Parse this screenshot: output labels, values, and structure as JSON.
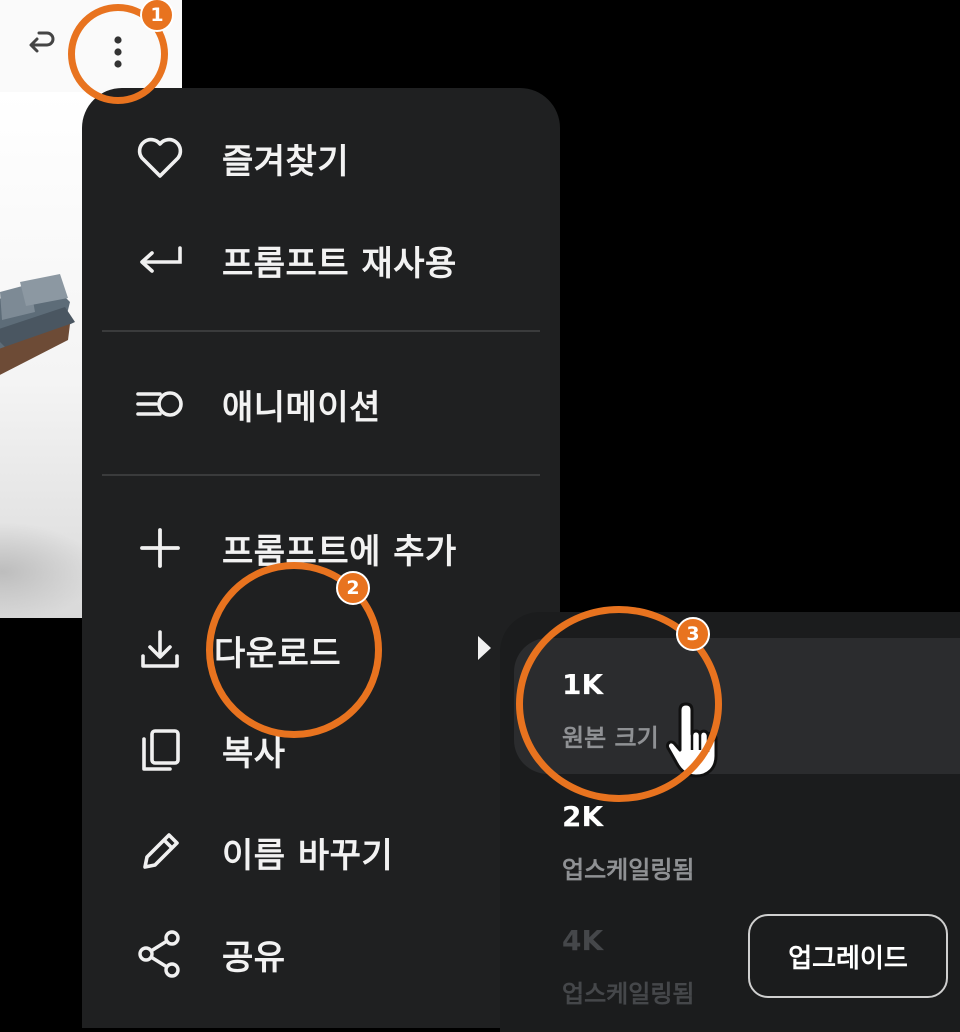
{
  "card": {
    "toolbar_icons": [
      "reuse-arrow-icon",
      "more-vertical-icon"
    ]
  },
  "menu": {
    "items": [
      {
        "label": "즐겨찾기",
        "icon": "heart-icon"
      },
      {
        "label": "프롬프트 재사용",
        "icon": "return-arrow-icon"
      },
      {
        "label": "애니메이션",
        "icon": "animation-icon"
      },
      {
        "label": "프롬프트에 추가",
        "icon": "plus-icon"
      },
      {
        "label": "다운로드",
        "icon": "download-icon"
      },
      {
        "label": "복사",
        "icon": "copy-icon"
      },
      {
        "label": "이름 바꾸기",
        "icon": "pencil-icon"
      },
      {
        "label": "공유",
        "icon": "share-icon"
      }
    ]
  },
  "download_submenu": {
    "options": [
      {
        "title": "1K",
        "desc": "원본 크기",
        "state": "hover"
      },
      {
        "title": "2K",
        "desc": "업스케일링됨",
        "state": "enabled"
      },
      {
        "title": "4K",
        "desc": "업스케일링됨",
        "state": "disabled"
      }
    ],
    "upgrade_label": "업그레이드"
  },
  "annotations": {
    "steps": [
      "1",
      "2",
      "3"
    ],
    "color": "#e8731f"
  },
  "colors": {
    "menu_bg": "#1f2021",
    "submenu_bg": "#1b1c1d",
    "hover_bg": "#2b2c2e",
    "muted_text": "#8f9194",
    "disabled_text": "#45474a"
  }
}
